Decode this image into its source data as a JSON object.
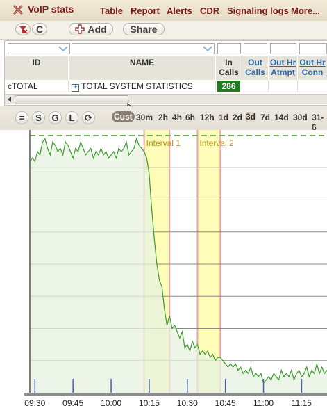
{
  "app": {
    "title": "VoIP stats",
    "menu": [
      "Table",
      "Report",
      "Alerts",
      "CDR",
      "Signaling logs",
      "More..."
    ]
  },
  "toolbar": {
    "btn_c": "C",
    "add_label": "Add",
    "share_label": "Share"
  },
  "table": {
    "columns": {
      "id": "ID",
      "name": "NAME",
      "in_calls": "In Calls",
      "out_calls": "Out Calls",
      "out_hr_atmpt": "Out Hr Atmpt",
      "out_hr_conn": "Out Hr Conn"
    },
    "row": {
      "id": "cTOTAL",
      "expand": "+",
      "name": "TOTAL SYSTEM STATISTICS",
      "in_calls": "286"
    }
  },
  "chart_controls": {
    "buttons": [
      "=",
      "S",
      "G",
      "L",
      "⟳"
    ],
    "ranges": [
      "Cust",
      "30m",
      "2h",
      "4h",
      "6h",
      "12h",
      "1d",
      "2d",
      "3d",
      "7d",
      "14d",
      "30d",
      "31-6"
    ],
    "active_range": "Cust",
    "highlighted_range": "3d"
  },
  "colors": {
    "accent": "#7a1a1a",
    "in_calls_bg": "#1e7d1e",
    "line": "#3d9a2c",
    "fill": "#e5f1e0",
    "band_fill": "#fffdb8",
    "band_edge": "#f3a0a8",
    "label": "#b6961e"
  },
  "chart_data": {
    "type": "area",
    "x_labels": [
      "09:30",
      "09:45",
      "10:00",
      "10:15",
      "10:30",
      "10:45",
      "11:00",
      "11:15"
    ],
    "x_domain": [
      "09:28",
      "11:25"
    ],
    "bands": [
      {
        "label": "Interval 1",
        "from": "10:13",
        "to": "10:23"
      },
      {
        "label": "Interval 2",
        "from": "10:34",
        "to": "10:43"
      }
    ],
    "y_range": [
      0,
      8
    ],
    "reference_line": 8,
    "grid": true,
    "series": [
      {
        "values": [
          [
            "09:28",
            7.2
          ],
          [
            "09:29",
            7.3
          ],
          [
            "09:30",
            7.2
          ],
          [
            "09:31",
            7.5
          ],
          [
            "09:32",
            7.4
          ],
          [
            "09:33",
            7.8
          ],
          [
            "09:34",
            7.9
          ],
          [
            "09:35",
            7.6
          ],
          [
            "09:36",
            7.4
          ],
          [
            "09:37",
            7.8
          ],
          [
            "09:38",
            7.7
          ],
          [
            "09:39",
            7.5
          ],
          [
            "09:40",
            7.6
          ],
          [
            "09:41",
            7.4
          ],
          [
            "09:42",
            7.8
          ],
          [
            "09:43",
            7.7
          ],
          [
            "09:44",
            7.5
          ],
          [
            "09:45",
            7.3
          ],
          [
            "09:46",
            7.6
          ],
          [
            "09:47",
            7.5
          ],
          [
            "09:48",
            7.8
          ],
          [
            "09:49",
            7.6
          ],
          [
            "09:50",
            7.4
          ],
          [
            "09:51",
            7.5
          ],
          [
            "09:52",
            7.6
          ],
          [
            "09:53",
            7.3
          ],
          [
            "09:54",
            7.5
          ],
          [
            "09:55",
            7.4
          ],
          [
            "09:56",
            7.6
          ],
          [
            "09:57",
            7.4
          ],
          [
            "09:58",
            7.5
          ],
          [
            "09:59",
            7.3
          ],
          [
            "10:00",
            7.4
          ],
          [
            "10:01",
            7.5
          ],
          [
            "10:02",
            7.3
          ],
          [
            "10:03",
            7.6
          ],
          [
            "10:04",
            7.5
          ],
          [
            "10:05",
            7.6
          ],
          [
            "10:06",
            7.8
          ],
          [
            "10:07",
            7.4
          ],
          [
            "10:08",
            7.5
          ],
          [
            "10:09",
            7.6
          ],
          [
            "10:10",
            7.9
          ],
          [
            "10:11",
            7.7
          ],
          [
            "10:12",
            7.6
          ],
          [
            "10:13",
            7.5
          ],
          [
            "10:14",
            7.3
          ],
          [
            "10:15",
            6.8
          ],
          [
            "10:16",
            5.7
          ],
          [
            "10:17",
            4.8
          ],
          [
            "10:18",
            4.0
          ],
          [
            "10:19",
            3.5
          ],
          [
            "10:20",
            3.3
          ],
          [
            "10:21",
            2.6
          ],
          [
            "10:22",
            2.1
          ],
          [
            "10:23",
            2.4
          ],
          [
            "10:24",
            2.0
          ],
          [
            "10:25",
            2.1
          ],
          [
            "10:26",
            1.9
          ],
          [
            "10:27",
            1.7
          ],
          [
            "10:28",
            1.9
          ],
          [
            "10:29",
            1.4
          ],
          [
            "10:30",
            1.5
          ],
          [
            "10:31",
            1.3
          ],
          [
            "10:32",
            1.6
          ],
          [
            "10:33",
            1.4
          ],
          [
            "10:34",
            1.5
          ],
          [
            "10:35",
            1.2
          ],
          [
            "10:36",
            1.3
          ],
          [
            "10:37",
            1.2
          ],
          [
            "10:38",
            1.3
          ],
          [
            "10:39",
            1.1
          ],
          [
            "10:40",
            1.2
          ],
          [
            "10:41",
            1.0
          ],
          [
            "10:42",
            1.1
          ],
          [
            "10:43",
            1.1
          ],
          [
            "10:44",
            1.0
          ],
          [
            "10:45",
            0.9
          ],
          [
            "10:46",
            0.8
          ],
          [
            "10:47",
            0.9
          ],
          [
            "10:48",
            0.8
          ],
          [
            "10:49",
            0.9
          ],
          [
            "10:50",
            0.7
          ],
          [
            "10:51",
            0.8
          ],
          [
            "10:52",
            0.6
          ],
          [
            "10:53",
            0.7
          ],
          [
            "10:54",
            0.6
          ],
          [
            "10:55",
            0.8
          ],
          [
            "10:56",
            0.5
          ],
          [
            "10:57",
            0.6
          ],
          [
            "10:58",
            0.5
          ],
          [
            "10:59",
            0.6
          ],
          [
            "11:00",
            0.3
          ],
          [
            "11:01",
            0.4
          ],
          [
            "11:02",
            0.5
          ],
          [
            "11:03",
            0.4
          ],
          [
            "11:04",
            0.6
          ],
          [
            "11:05",
            0.5
          ],
          [
            "11:06",
            0.4
          ],
          [
            "11:07",
            0.7
          ],
          [
            "11:08",
            0.5
          ],
          [
            "11:09",
            0.6
          ],
          [
            "11:10",
            0.5
          ],
          [
            "11:11",
            0.7
          ],
          [
            "11:12",
            0.4
          ],
          [
            "11:13",
            0.6
          ],
          [
            "11:14",
            0.7
          ],
          [
            "11:15",
            0.5
          ],
          [
            "11:16",
            0.6
          ],
          [
            "11:17",
            0.8
          ],
          [
            "11:18",
            0.5
          ],
          [
            "11:19",
            0.7
          ],
          [
            "11:20",
            0.6
          ],
          [
            "11:21",
            0.9
          ],
          [
            "11:22",
            0.6
          ],
          [
            "11:23",
            0.8
          ],
          [
            "11:24",
            0.6
          ],
          [
            "11:25",
            0.7
          ]
        ]
      }
    ]
  }
}
